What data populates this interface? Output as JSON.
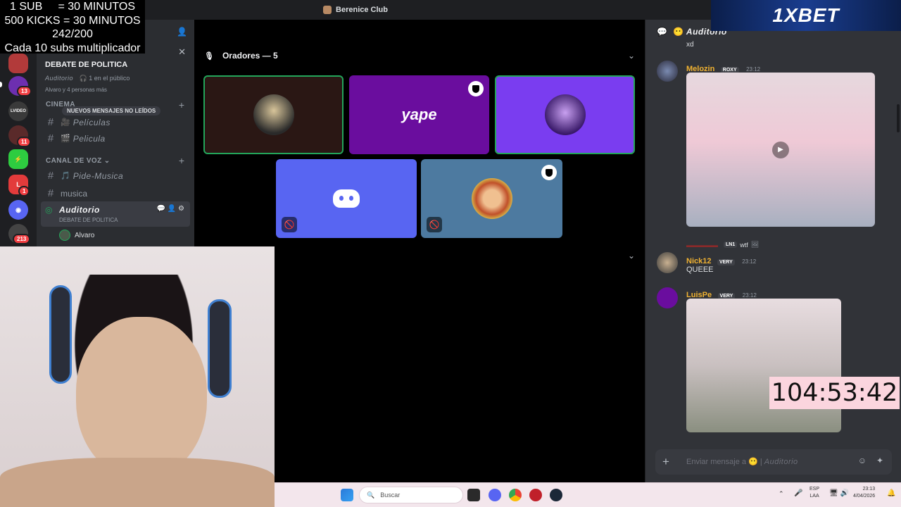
{
  "overlay": {
    "line1": "1 SUB     = 30 MINUTOS",
    "line2": "500 KICKS = 30 MINUTOS",
    "line3": "242/200",
    "line4": "Cada 10 subs multiplicador"
  },
  "window": {
    "title": "Berenice Club"
  },
  "ad": {
    "brand": "1XBET"
  },
  "servers": {
    "badges": [
      "13",
      "11",
      "1",
      "213"
    ]
  },
  "sidebar": {
    "event_title": "DEBATE DE POLITICA",
    "event_channel": "Auditorio",
    "event_audience": "1 en el público",
    "event_people": "Alvaro y 4 personas más",
    "category_cinema": "CINEMA",
    "unread_pill": "NUEVOS MENSAJES NO LEÍDOS",
    "channels_cinema": [
      {
        "name": "Películas",
        "emoji": "🎥"
      },
      {
        "name": "Pelicula",
        "emoji": "🎬"
      }
    ],
    "category_voice": "CANAL DE VOZ",
    "channels_voice": [
      {
        "name": "Pide-Musica",
        "emoji": "🎵"
      },
      {
        "name": "musica",
        "emoji": ""
      }
    ],
    "active_voice": {
      "name": "Auditorio",
      "topic": "DEBATE DE POLITICA"
    },
    "voice_user": "Alvaro"
  },
  "stage": {
    "speakers_label": "Oradores — 5"
  },
  "tiles": [
    {
      "label": "speaker-1",
      "bg": "#2a1714"
    },
    {
      "label": "yape",
      "bg": "#6a0d9e",
      "text": "yape"
    },
    {
      "label": "speaker-3",
      "bg": "#7a3df0"
    },
    {
      "label": "discord",
      "bg": "#5865f2"
    },
    {
      "label": "speaker-5",
      "bg": "#4d7aa0"
    }
  ],
  "chat": {
    "channel": "Auditorio",
    "prev_fragment": "xd",
    "messages": [
      {
        "author": "Melozin",
        "role": "ROXY",
        "time": "23:12",
        "color": "#f0b232"
      },
      {
        "author": "Nick12",
        "role": "VERY",
        "time": "23:12",
        "color": "#f0b232",
        "text": "QUEEE",
        "reply_role": "LN1",
        "reply_text": "wtf"
      },
      {
        "author": "LuisPe",
        "role": "VERY",
        "time": "23:12",
        "color": "#f0b232"
      }
    ],
    "input_placeholder": "Enviar mensaje a",
    "input_channel": "Auditorio"
  },
  "timer": {
    "value": "104:53:42"
  },
  "taskbar": {
    "search_placeholder": "Buscar",
    "lang1": "ESP",
    "lang2": "LAA",
    "time": "23:13",
    "date": "4/04/2026"
  }
}
